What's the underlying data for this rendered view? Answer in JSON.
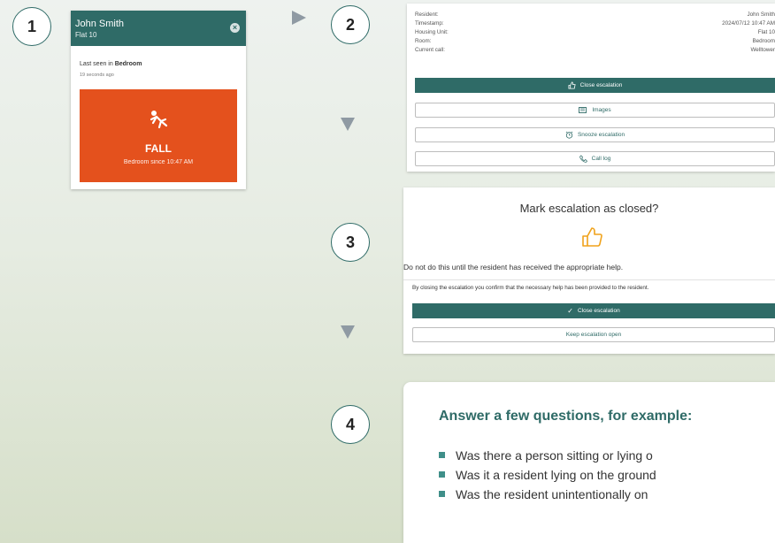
{
  "steps": [
    "1",
    "2",
    "3",
    "4"
  ],
  "card1": {
    "name": "John Smith",
    "flat": "Flat 10",
    "seen_prefix": "Last seen in ",
    "seen_room": "Bedroom",
    "ago": "19 seconds ago",
    "alert_title": "FALL",
    "alert_since": "Bedroom since 10:47 AM",
    "alert_color": "#e4511d"
  },
  "panel2": {
    "labels": [
      "Resident:",
      "Timestamp:",
      "Housing Unit:",
      "Room:",
      "Current call:"
    ],
    "values": [
      "John Smith",
      "2024/07/12 10:47 AM",
      "Flat 10",
      "Bedroom",
      "Welltower"
    ],
    "buttons": {
      "close": "Close escalation",
      "images": "Images",
      "snooze": "Snooze escalation",
      "call_log": "Call log"
    }
  },
  "panel3": {
    "title": "Mark escalation as closed?",
    "warning": "Do not do this until the resident has received the appropriate help.",
    "confirm": "By closing the escalation you confirm that the necessary help has been provided to the resident.",
    "close_button": "Close escalation",
    "keep_button": "Keep escalation open"
  },
  "panel4": {
    "heading": "Answer a few questions, for example:",
    "questions": [
      "Was there a person sitting or lying o",
      "Was it a resident lying on the ground",
      "Was the resident unintentionally on"
    ]
  },
  "colors": {
    "accent": "#2f6b67",
    "alert": "#e4511d",
    "thumb": "#f0a21a"
  }
}
